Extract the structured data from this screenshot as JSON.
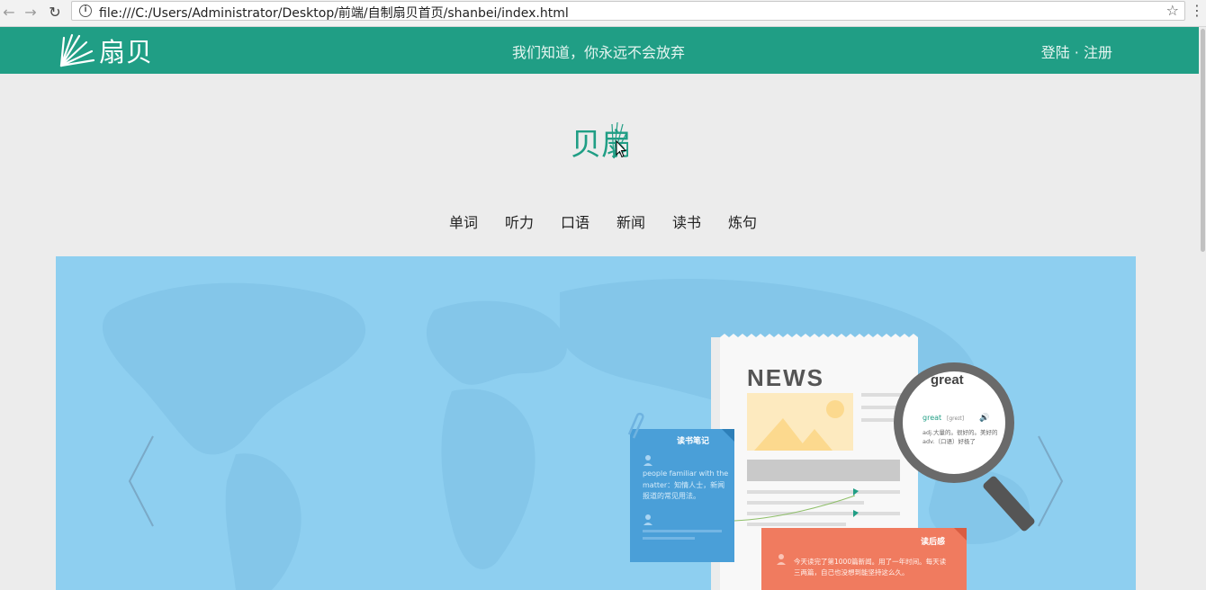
{
  "browser": {
    "url": "file:///C:/Users/Administrator/Desktop/前端/自制扇贝首页/shanbei/index.html"
  },
  "header": {
    "logo_text": "扇贝",
    "slogan": "我们知道，你永远不会放弃",
    "login_label": "登陆",
    "separator": "·",
    "register_label": "注册"
  },
  "center_logo_text": "贝扇",
  "nav": {
    "items": [
      "单词",
      "听力",
      "口语",
      "新闻",
      "读书",
      "炼句"
    ]
  },
  "banner": {
    "news_title": "NEWS",
    "magnifier_word": "great",
    "magnifier_entry": "great",
    "magnifier_phonetic": "[greɪt]",
    "magnifier_def1": "adj.大量的。很好的。美好的",
    "magnifier_def2": "adv.（口语）好极了",
    "note_title": "读书笔记",
    "note_text1": "people familiar with the",
    "note_text2": "matter：知情人士，新闻",
    "note_text3": "报道的常见用法。",
    "review_title": "读后感",
    "review_text1": "今天读完了第1000篇新闻。用了一年时间。每天读",
    "review_text2": "三两篇，自己也没想到能坚持这么久。",
    "colors": {
      "banner_bg": "#8ecff0",
      "note_blue": "#4a9fd8",
      "review_orange": "#f07b5f",
      "brand_green": "#209e85"
    }
  }
}
